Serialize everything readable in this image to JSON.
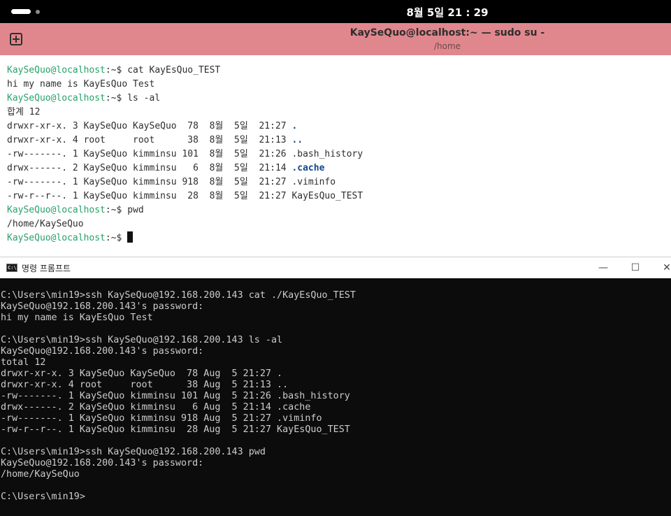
{
  "topbar": {
    "clock": "8월 5일  21 : 29"
  },
  "linux_terminal": {
    "title": "KaySeQuo@localhost:~ — sudo su -",
    "subtitle": "/home",
    "lines": [
      {
        "prompt": "KaySeQuo@localhost",
        "path": ":~$ ",
        "cmd": "cat KayEsQuo_TEST"
      },
      {
        "text": "hi my name is KayEsQuo Test"
      },
      {
        "prompt": "KaySeQuo@localhost",
        "path": ":~$ ",
        "cmd": "ls -al"
      },
      {
        "text": "합계 12"
      },
      {
        "text": "drwxr-xr-x. 3 KaySeQuo KaySeQuo  78  8월  5일  21:27 ",
        "name": ".",
        "dir": true
      },
      {
        "text": "drwxr-xr-x. 4 root     root      38  8월  5일  21:13 ",
        "name": "..",
        "dir": true
      },
      {
        "text": "-rw-------. 1 KaySeQuo kimminsu 101  8월  5일  21:26 ",
        "name": ".bash_history",
        "dir": false
      },
      {
        "text": "drwx------. 2 KaySeQuo kimminsu   6  8월  5일  21:14 ",
        "name": ".cache",
        "dir": true
      },
      {
        "text": "-rw-------. 1 KaySeQuo kimminsu 918  8월  5일  21:27 ",
        "name": ".viminfo",
        "dir": false
      },
      {
        "text": "-rw-r--r--. 1 KaySeQuo kimminsu  28  8월  5일  21:27 ",
        "name": "KayEsQuo_TEST",
        "dir": false
      },
      {
        "prompt": "KaySeQuo@localhost",
        "path": ":~$ ",
        "cmd": "pwd"
      },
      {
        "text": "/home/KaySeQuo"
      },
      {
        "prompt": "KaySeQuo@localhost",
        "path": ":~$ ",
        "cmd": "",
        "cursor": true
      }
    ]
  },
  "cmd_window": {
    "title": "명령 프롬프트",
    "controls": {
      "minimize": "—",
      "maximize": "☐",
      "close": "✕"
    },
    "lines": [
      "C:\\Users\\min19>ssh KaySeQuo@192.168.200.143 cat ./KayEsQuo_TEST",
      "KaySeQuo@192.168.200.143's password:",
      "hi my name is KayEsQuo Test",
      "",
      "C:\\Users\\min19>ssh KaySeQuo@192.168.200.143 ls -al",
      "KaySeQuo@192.168.200.143's password:",
      "total 12",
      "drwxr-xr-x. 3 KaySeQuo KaySeQuo  78 Aug  5 21:27 .",
      "drwxr-xr-x. 4 root     root      38 Aug  5 21:13 ..",
      "-rw-------. 1 KaySeQuo kimminsu 101 Aug  5 21:26 .bash_history",
      "drwx------. 2 KaySeQuo kimminsu   6 Aug  5 21:14 .cache",
      "-rw-------. 1 KaySeQuo kimminsu 918 Aug  5 21:27 .viminfo",
      "-rw-r--r--. 1 KaySeQuo kimminsu  28 Aug  5 21:27 KayEsQuo_TEST",
      "",
      "C:\\Users\\min19>ssh KaySeQuo@192.168.200.143 pwd",
      "KaySeQuo@192.168.200.143's password:",
      "/home/KaySeQuo",
      "",
      "C:\\Users\\min19>"
    ]
  }
}
